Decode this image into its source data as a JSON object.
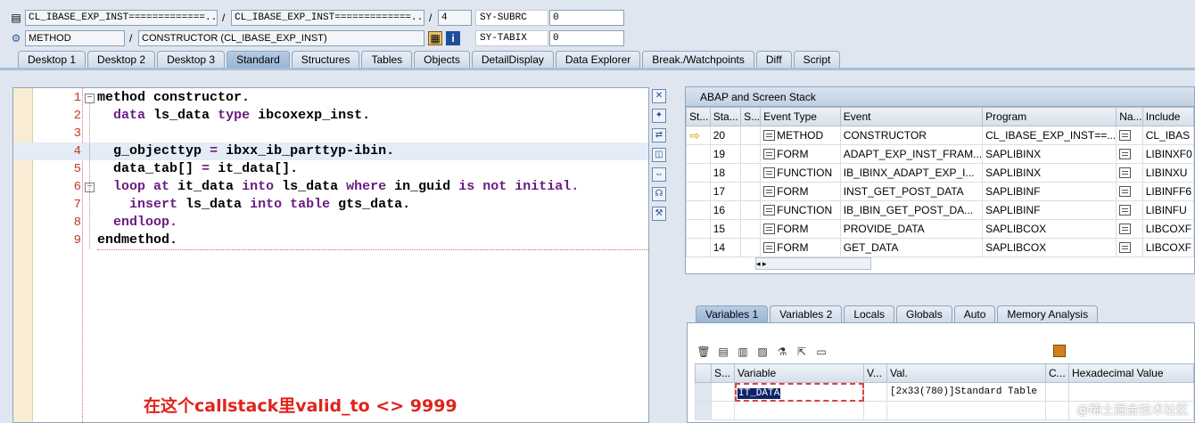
{
  "header": {
    "row1": {
      "program_main": "CL_IBASE_EXP_INST=============...",
      "program_include": "CL_IBASE_EXP_INST=============...",
      "line": "4",
      "sysvar_name": "SY-SUBRC",
      "sysvar_value": "0"
    },
    "row2": {
      "event_type": "METHOD",
      "event": "CONSTRUCTOR (CL_IBASE_EXP_INST)",
      "sysvar_name": "SY-TABIX",
      "sysvar_value": "0"
    },
    "separator": "/"
  },
  "tabs": [
    "Desktop 1",
    "Desktop 2",
    "Desktop 3",
    "Standard",
    "Structures",
    "Tables",
    "Objects",
    "DetailDisplay",
    "Data Explorer",
    "Break./Watchpoints",
    "Diff",
    "Script"
  ],
  "active_tab": "Standard",
  "editor": {
    "lines": [
      {
        "n": "1",
        "html": "<span class=\"bl\">method constructor.</span>"
      },
      {
        "n": "2",
        "html": "  <span class=\"kw\">data</span> <span class=\"bl\">ls_data</span> <span class=\"kw\">type</span> <span class=\"bl\">ibcoxexp_inst.</span>"
      },
      {
        "n": "3",
        "html": ""
      },
      {
        "n": "4",
        "html": "  <span class=\"bl\">g_objecttyp</span> <span class=\"kw\">=</span> <span class=\"bl\">ibxx_ib_parttyp-ibin.</span>"
      },
      {
        "n": "5",
        "html": "  <span class=\"bl\">data_tab[]</span> <span class=\"kw\">=</span> <span class=\"bl\">it_data[].</span>"
      },
      {
        "n": "6",
        "html": "  <span class=\"kw\">loop at</span> <span class=\"bl\">it_data</span> <span class=\"kw\">into</span> <span class=\"bl\">ls_data</span> <span class=\"kw\">where</span> <span class=\"bl\">in_guid</span> <span class=\"kw\">is not initial.</span>"
      },
      {
        "n": "7",
        "html": "    <span class=\"kw\">insert</span> <span class=\"bl\">ls_data</span> <span class=\"kw\">into table</span> <span class=\"bl\">gts_data.</span>"
      },
      {
        "n": "8",
        "html": "  <span class=\"kw\">endloop.</span>"
      },
      {
        "n": "9",
        "html": "<span class=\"bl\">endmethod.</span>"
      }
    ],
    "annotation": "在这个callstack里valid_to <> 9999"
  },
  "callstack": {
    "title": "ABAP and Screen Stack",
    "columns": [
      "St...",
      "Sta...",
      "S...",
      "Event Type",
      "Event",
      "Program",
      "Na...",
      "Include"
    ],
    "rows": [
      {
        "level": "20",
        "type": "METHOD",
        "event": "CONSTRUCTOR",
        "program": "CL_IBASE_EXP_INST==...",
        "include": "CL_IBAS",
        "current": true
      },
      {
        "level": "19",
        "type": "FORM",
        "event": "ADAPT_EXP_INST_FRAM...",
        "program": "SAPLIBINX",
        "include": "LIBINXF0",
        "current": false
      },
      {
        "level": "18",
        "type": "FUNCTION",
        "event": "IB_IBINX_ADAPT_EXP_I...",
        "program": "SAPLIBINX",
        "include": "LIBINXU",
        "current": false
      },
      {
        "level": "17",
        "type": "FORM",
        "event": "INST_GET_POST_DATA",
        "program": "SAPLIBINF",
        "include": "LIBINFF6",
        "current": false
      },
      {
        "level": "16",
        "type": "FUNCTION",
        "event": "IB_IBIN_GET_POST_DA...",
        "program": "SAPLIBINF",
        "include": "LIBINFU",
        "current": false
      },
      {
        "level": "15",
        "type": "FORM",
        "event": "PROVIDE_DATA",
        "program": "SAPLIBCOX",
        "include": "LIBCOXF",
        "current": false
      },
      {
        "level": "14",
        "type": "FORM",
        "event": "GET_DATA",
        "program": "SAPLIBCOX",
        "include": "LIBCOXF",
        "current": false
      }
    ]
  },
  "variables": {
    "tabs": [
      "Variables 1",
      "Variables 2",
      "Locals",
      "Globals",
      "Auto",
      "Memory Analysis"
    ],
    "active_tab": "Variables 1",
    "columns": [
      "S...",
      "Variable",
      "V...",
      "Val.",
      "C...",
      "Hexadecimal Value"
    ],
    "rows": [
      {
        "variable": "IT_DATA",
        "value": "[2x33(780)]Standard Table"
      }
    ]
  },
  "watermark": "@稀土掘金技术社区"
}
